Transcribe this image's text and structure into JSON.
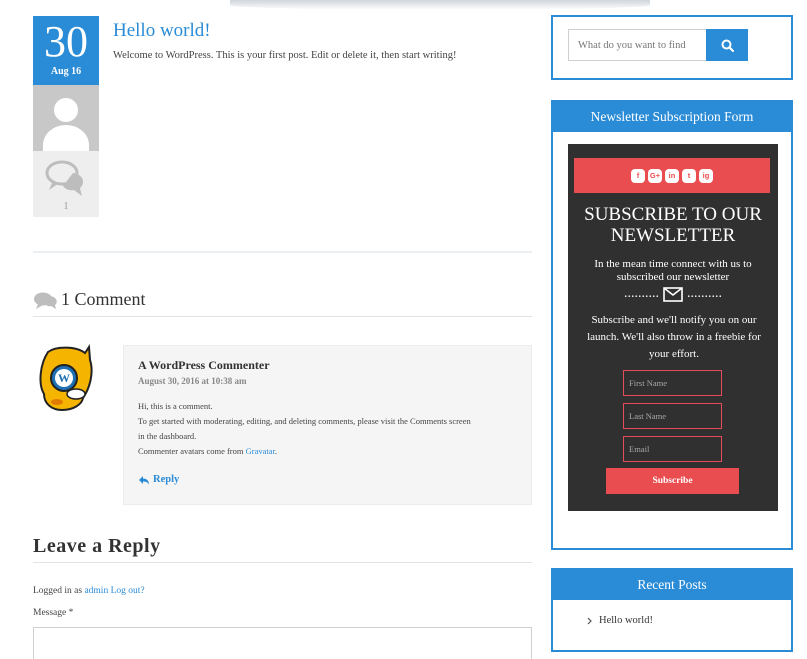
{
  "post": {
    "day": "30",
    "month": "Aug 16",
    "title": "Hello world!",
    "excerpt": "Welcome to WordPress. This is your first post. Edit or delete it, then start writing!",
    "comment_count": "1"
  },
  "comments": {
    "heading": "1 Comment",
    "items": [
      {
        "author": "A WordPress Commenter",
        "date": "August 30, 2016 at 10:38 am",
        "line1": "Hi, this is a comment.",
        "line2": "To get started with moderating, editing, and deleting comments, please visit the Comments screen",
        "line3": "in the dashboard.",
        "line4_prefix": "Commenter avatars come from ",
        "line4_link": "Gravatar",
        "line4_suffix": ".",
        "reply_label": "Reply"
      }
    ]
  },
  "reply_form": {
    "heading": "Leave a Reply",
    "logged_in_prefix": "Logged in as ",
    "user": "admin",
    "logout": "Log out?",
    "message_label": "Message *"
  },
  "sidebar": {
    "search": {
      "placeholder": "What do you want to find"
    },
    "newsletter": {
      "title": "Newsletter Subscription Form",
      "social": [
        "f",
        "G+",
        "in",
        "t",
        "ig"
      ],
      "heading_line1": "SUBSCRIBE TO OUR",
      "heading_line2": "NEWSLETTER",
      "subtext": "In the mean time connect with us to subscribed our newsletter",
      "dots_left": "..........",
      "dots_right": "..........",
      "promo": "Subscribe and we'll notify you on our launch. We'll also throw in a freebie for your effort.",
      "first_name_placeholder": "First Name",
      "last_name_placeholder": "Last Name",
      "email_placeholder": "Email",
      "submit_label": "Subscribe"
    },
    "recent_posts": {
      "title": "Recent Posts",
      "items": [
        "Hello world!"
      ]
    }
  },
  "colors": {
    "accent": "#2a8bd6",
    "newsletter_red": "#ea4d50",
    "newsletter_bg": "#303030"
  }
}
